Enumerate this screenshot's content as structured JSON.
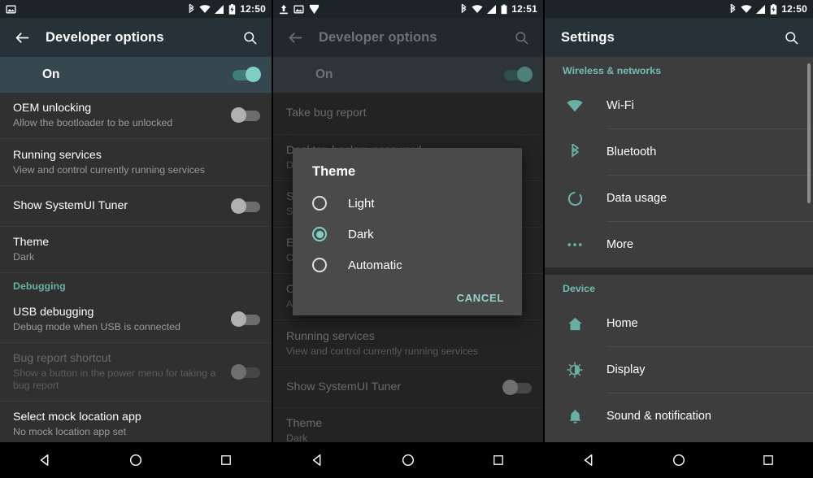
{
  "panels": [
    {
      "statusbar": {
        "time": "12:50",
        "icons_left": [
          "image-icon"
        ],
        "icons_right": [
          "bluetooth-icon",
          "wifi-icon",
          "signal-icon",
          "battery-charging-icon"
        ]
      },
      "appbar": {
        "title": "Developer options",
        "back": "back-arrow-icon",
        "search": "search-icon"
      },
      "master": {
        "label": "On",
        "enabled": true
      },
      "items": [
        {
          "title": "OEM unlocking",
          "summary": "Allow the bootloader to be unlocked",
          "toggle": "off"
        },
        {
          "title": "Running services",
          "summary": "View and control currently running services"
        },
        {
          "title": "Show SystemUI Tuner",
          "summary": "",
          "toggle": "off"
        },
        {
          "title": "Theme",
          "summary": "Dark"
        }
      ],
      "section": "Debugging",
      "items2": [
        {
          "title": "USB debugging",
          "summary": "Debug mode when USB is connected",
          "toggle": "off"
        },
        {
          "title": "Bug report shortcut",
          "summary": "Show a button in the power menu for taking a bug report",
          "toggle": "off",
          "disabled": true
        },
        {
          "title": "Select mock location app",
          "summary": "No mock location app set"
        }
      ]
    },
    {
      "statusbar": {
        "time": "12:51",
        "icons_left": [
          "upload-icon",
          "image-icon",
          "download-icon"
        ],
        "icons_right": [
          "bluetooth-icon",
          "wifi-icon",
          "signal-icon",
          "battery-icon"
        ]
      },
      "appbar": {
        "title": "Developer options",
        "back": "back-arrow-icon",
        "search": "search-icon"
      },
      "master": {
        "label": "On",
        "enabled": true
      },
      "items": [
        {
          "title": "Take bug report",
          "summary": ""
        },
        {
          "title": "Desktop backup password",
          "summary": "D"
        },
        {
          "title": "S",
          "summary": "S"
        },
        {
          "title": "E",
          "summary": "C"
        },
        {
          "title": "O",
          "summary": "A"
        },
        {
          "title": "Running services",
          "summary": "View and control currently running services"
        },
        {
          "title": "Show SystemUI Tuner",
          "summary": "",
          "toggle": "off"
        },
        {
          "title": "Theme",
          "summary": "Dark"
        }
      ],
      "dialog": {
        "title": "Theme",
        "options": [
          {
            "label": "Light",
            "selected": false
          },
          {
            "label": "Dark",
            "selected": true
          },
          {
            "label": "Automatic",
            "selected": false
          }
        ],
        "cancel": "CANCEL"
      }
    },
    {
      "statusbar": {
        "time": "12:50",
        "icons_left": [],
        "icons_right": [
          "bluetooth-icon",
          "wifi-icon",
          "signal-icon",
          "battery-charging-icon"
        ]
      },
      "appbar": {
        "title": "Settings",
        "search": "search-icon"
      },
      "groups": [
        {
          "header": "Wireless & networks",
          "rows": [
            {
              "label": "Wi-Fi",
              "icon": "wifi-icon"
            },
            {
              "label": "Bluetooth",
              "icon": "bluetooth-icon"
            },
            {
              "label": "Data usage",
              "icon": "data-usage-icon"
            },
            {
              "label": "More",
              "icon": "more-dots-icon"
            }
          ]
        },
        {
          "header": "Device",
          "rows": [
            {
              "label": "Home",
              "icon": "home-icon"
            },
            {
              "label": "Display",
              "icon": "display-icon"
            },
            {
              "label": "Sound & notification",
              "icon": "bell-icon"
            }
          ]
        }
      ]
    }
  ],
  "navbar": {
    "back": "nav-back-triangle-icon",
    "home": "nav-home-circle-icon",
    "recents": "nav-recents-square-icon"
  },
  "colors": {
    "accent": "#7fcfc5",
    "appbar": "#263238",
    "list_bg": "#303030",
    "master_bg": "#37474f",
    "settings_bg": "#3d3d3d"
  }
}
